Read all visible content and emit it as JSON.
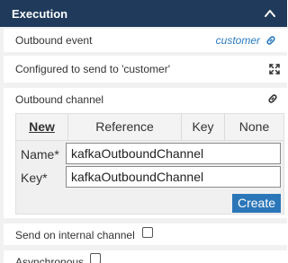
{
  "header": {
    "title": "Execution",
    "collapse_icon": "chevron-up-icon"
  },
  "outbound_event": {
    "label": "Outbound event",
    "value": "customer",
    "icon": "link-icon"
  },
  "configured": {
    "label": "Configured to send to 'customer'",
    "icon": "expand-icon"
  },
  "outbound_channel": {
    "label": "Outbound channel",
    "icon": "link-icon",
    "tabs": [
      {
        "label": "New",
        "active": true
      },
      {
        "label": "Reference",
        "active": false
      },
      {
        "label": "Key",
        "active": false
      },
      {
        "label": "None",
        "active": false
      }
    ],
    "name_label": "Name*",
    "name_value": "kafkaOutboundChannel",
    "key_label": "Key*",
    "key_value": "kafkaOutboundChannel",
    "create_label": "Create"
  },
  "send_internal": {
    "label": "Send on internal channel",
    "checked": false
  },
  "asynchronous": {
    "label": "Asynchronous",
    "checked": false
  },
  "colors": {
    "header_bg": "#1f3a5a",
    "accent": "#2b76b8",
    "link": "#2b7bbf"
  }
}
